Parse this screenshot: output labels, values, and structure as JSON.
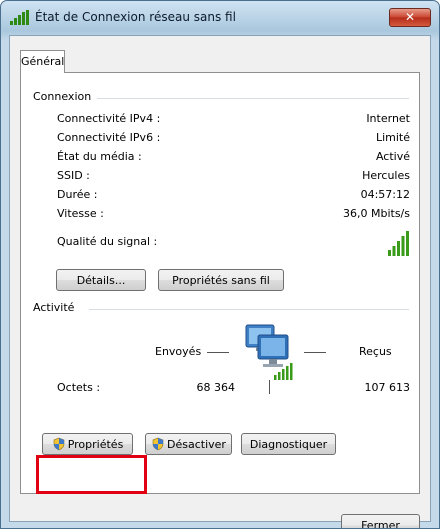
{
  "window": {
    "title": "État de Connexion réseau sans fil",
    "close_glyph": "✕"
  },
  "tabs": [
    {
      "label": "Général",
      "selected": true
    }
  ],
  "connexion": {
    "title": "Connexion",
    "rows": [
      {
        "label": "Connectivité IPv4 :",
        "value": "Internet"
      },
      {
        "label": "Connectivité IPv6 :",
        "value": "Limité"
      },
      {
        "label": "État du média :",
        "value": "Activé"
      },
      {
        "label": "SSID :",
        "value": "Hercules"
      },
      {
        "label": "Durée :",
        "value": "04:57:12"
      },
      {
        "label": "Vitesse :",
        "value": "36,0 Mbits/s"
      }
    ],
    "signal_label": "Qualité du signal :",
    "signal_bars": 5,
    "signal_bars_max": 5,
    "details_button": "Détails...",
    "wireless_props_button": "Propriétés sans fil"
  },
  "activite": {
    "title": "Activité",
    "sent_label": "Envoyés",
    "received_label": "Reçus",
    "bytes_label": "Octets :",
    "bytes_sent": "68 364",
    "bytes_received": "107 613",
    "icon": "network-computers-icon"
  },
  "actions": {
    "properties_button": "Propriétés",
    "disable_button": "Désactiver",
    "diagnose_button": "Diagnostiquer"
  },
  "footer": {
    "close_button": "Fermer"
  },
  "colors": {
    "signal_green": "#3a9a1a",
    "highlight_red": "#e00012",
    "titlebar_blue": "#a9c7dd"
  }
}
